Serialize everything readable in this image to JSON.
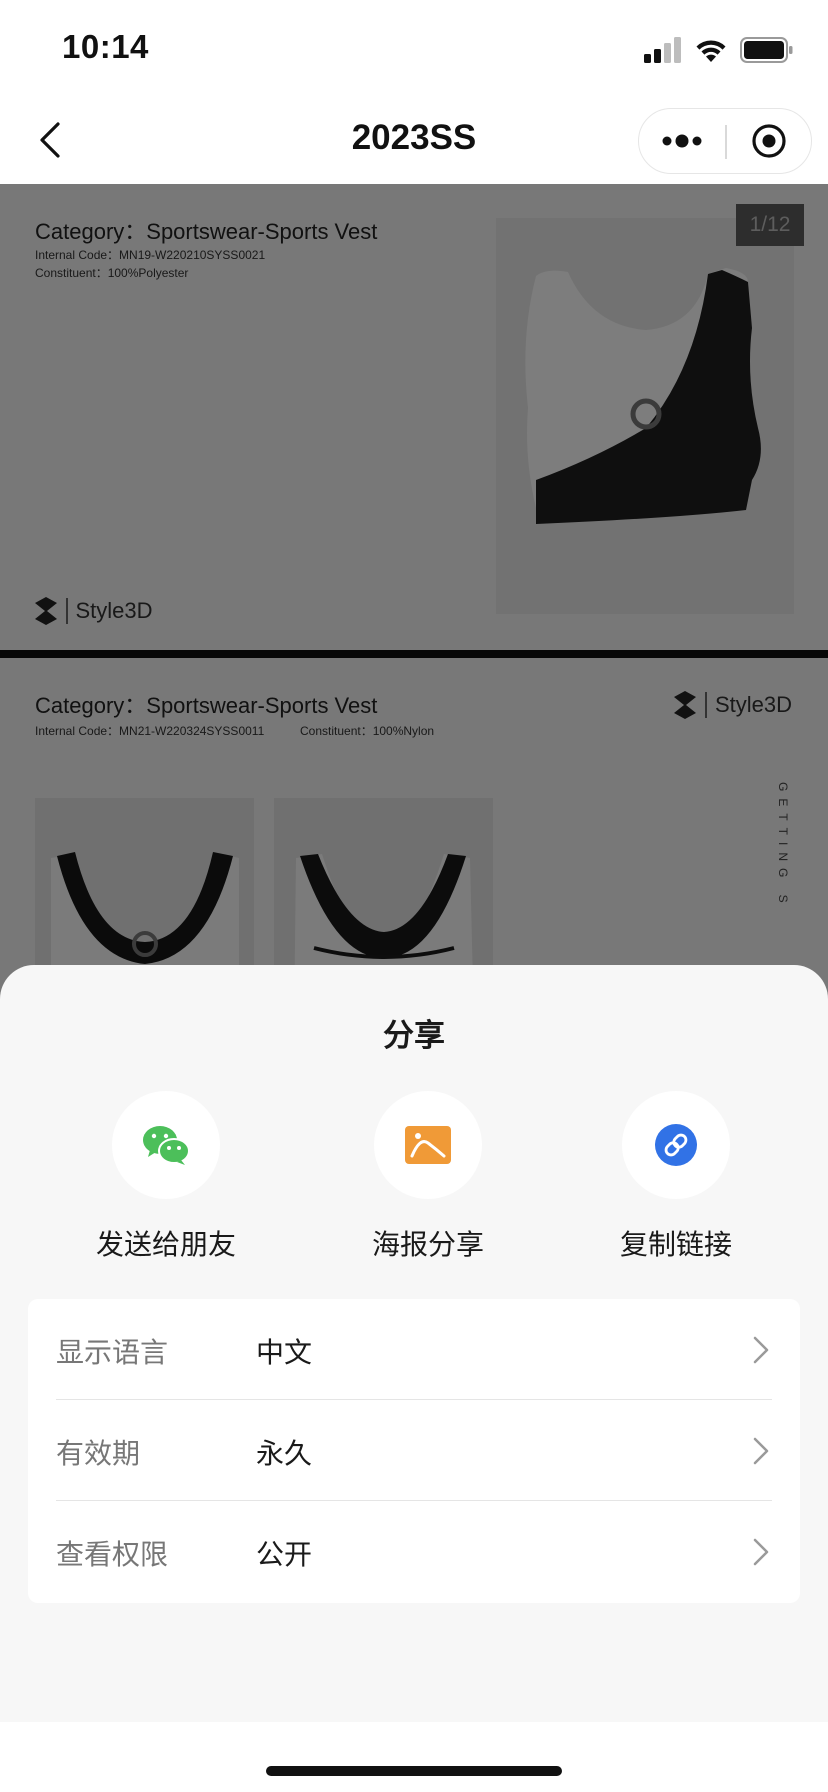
{
  "status_bar": {
    "time": "10:14"
  },
  "nav": {
    "title": "2023SS"
  },
  "pages": [
    {
      "category": "Category：Sportswear-Sports Vest",
      "internal_code": "Internal Code：MN19-W220210SYSS0021",
      "constituent": "Constituent：100%Polyester",
      "counter": "1/12",
      "brand": "Style3D"
    },
    {
      "category": "Category：Sportswear-Sports Vest",
      "internal_code": "Internal Code：MN21-W220324SYSS0011",
      "constituent": "Constituent：100%Nylon",
      "brand": "Style3D",
      "side_text": "GETTING S"
    }
  ],
  "share_sheet": {
    "title": "分享",
    "options": [
      {
        "label": "发送给朋友",
        "icon": "wechat-icon",
        "color": "#4cbf5a"
      },
      {
        "label": "海报分享",
        "icon": "poster-icon",
        "color": "#f09a37"
      },
      {
        "label": "复制链接",
        "icon": "link-icon",
        "color": "#3172e6"
      }
    ],
    "settings": [
      {
        "label": "显示语言",
        "value": "中文"
      },
      {
        "label": "有效期",
        "value": "永久"
      },
      {
        "label": "查看权限",
        "value": "公开"
      }
    ]
  }
}
